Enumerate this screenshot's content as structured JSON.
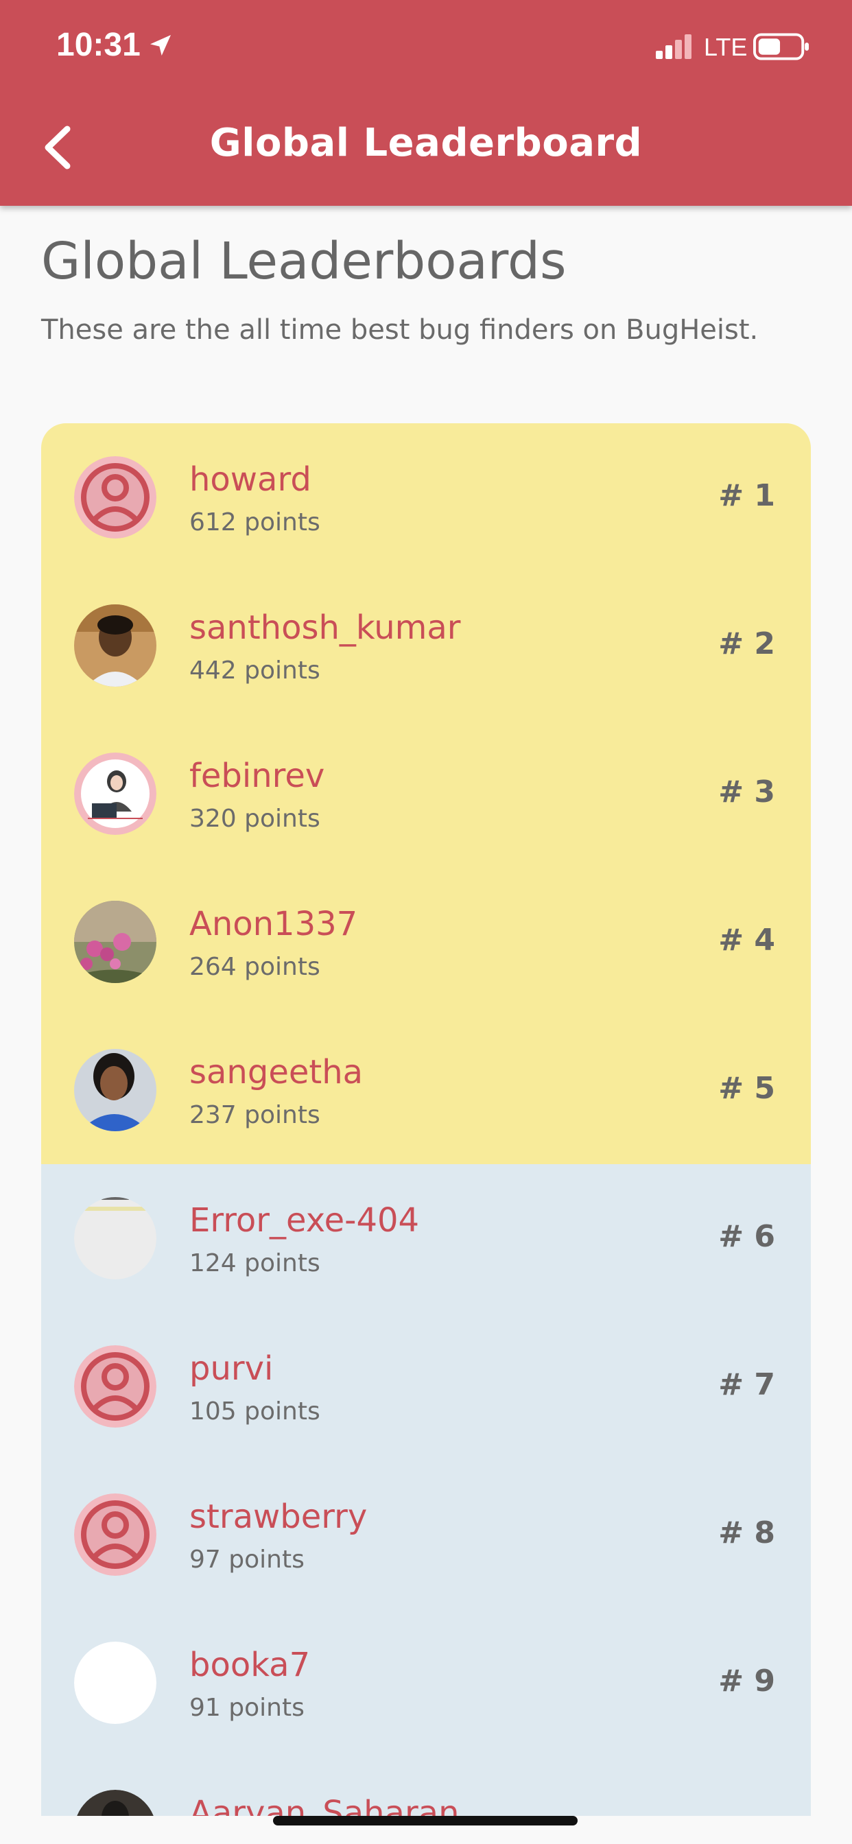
{
  "status_bar": {
    "time": "10:31",
    "network": "LTE"
  },
  "header": {
    "title": "Global Leaderboard",
    "back_icon": "chevron-left-icon",
    "background": "#c94e57"
  },
  "page": {
    "title": "Global Leaderboards",
    "subtitle": "These are the all time best bug finders on BugHeist."
  },
  "colors": {
    "accent": "#c94e57",
    "top_rank_bg": "#f8eb9a",
    "rest_bg": "#dee9f0"
  },
  "leaderboard": [
    {
      "username": "howard",
      "points": "612 points",
      "rank": "# 1",
      "avatar": "default-user-icon"
    },
    {
      "username": "santhosh_kumar",
      "points": "442 points",
      "rank": "# 2",
      "avatar": "photo"
    },
    {
      "username": "febinrev",
      "points": "320 points",
      "rank": "# 3",
      "avatar": "photo"
    },
    {
      "username": "Anon1337",
      "points": "264 points",
      "rank": "# 4",
      "avatar": "photo"
    },
    {
      "username": "sangeetha",
      "points": "237 points",
      "rank": "# 5",
      "avatar": "photo"
    },
    {
      "username": "Error_exe-404",
      "points": "124 points",
      "rank": "# 6",
      "avatar": "photo"
    },
    {
      "username": "purvi",
      "points": "105 points",
      "rank": "# 7",
      "avatar": "default-user-icon"
    },
    {
      "username": "strawberry",
      "points": "97 points",
      "rank": "# 8",
      "avatar": "default-user-icon"
    },
    {
      "username": "booka7",
      "points": "91 points",
      "rank": "# 9",
      "avatar": "photo"
    },
    {
      "username": "Aaryan_Saharan",
      "points": "",
      "rank": "",
      "avatar": "photo"
    }
  ]
}
